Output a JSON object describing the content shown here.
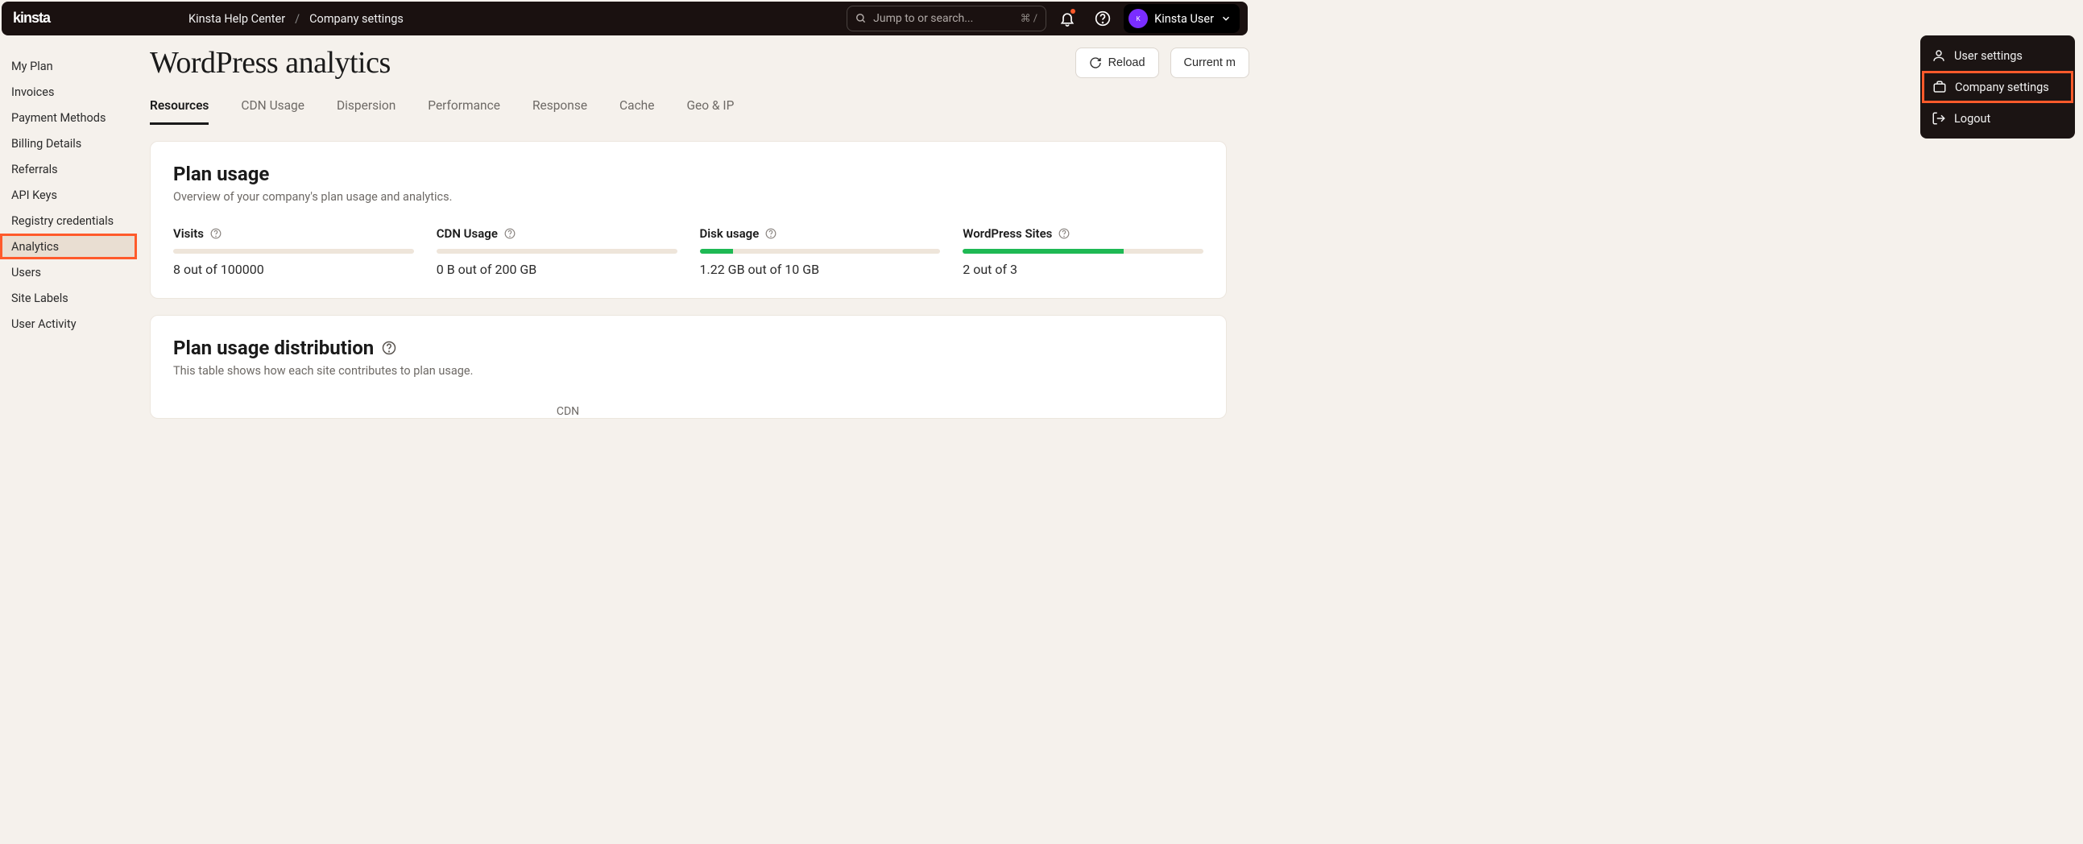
{
  "header": {
    "logo_text": "kinsta",
    "breadcrumb": [
      "Kinsta Help Center",
      "Company settings"
    ],
    "search_placeholder": "Jump to or search...",
    "search_kbd": "⌘ /",
    "user_name": "Kinsta User"
  },
  "user_menu": {
    "items": [
      {
        "label": "User settings"
      },
      {
        "label": "Company settings",
        "highlight": true
      },
      {
        "label": "Logout"
      }
    ]
  },
  "sidebar": {
    "items": [
      "My Plan",
      "Invoices",
      "Payment Methods",
      "Billing Details",
      "Referrals",
      "API Keys",
      "Registry credentials",
      "Analytics",
      "Users",
      "Site Labels",
      "User Activity"
    ],
    "active": "Analytics"
  },
  "page": {
    "title": "WordPress analytics",
    "reload_label": "Reload",
    "period_label": "Current m"
  },
  "tabs": [
    "Resources",
    "CDN Usage",
    "Dispersion",
    "Performance",
    "Response",
    "Cache",
    "Geo & IP"
  ],
  "tabs_active": "Resources",
  "plan_usage": {
    "title": "Plan usage",
    "subtitle": "Overview of your company's plan usage and analytics.",
    "metrics": [
      {
        "name": "Visits",
        "value": "8 out of 100000",
        "fill_pct": 0
      },
      {
        "name": "CDN Usage",
        "value": "0 B out of 200 GB",
        "fill_pct": 0
      },
      {
        "name": "Disk usage",
        "value": "1.22 GB out of 10 GB",
        "fill_pct": 14
      },
      {
        "name": "WordPress Sites",
        "value": "2 out of 3",
        "fill_pct": 67
      }
    ]
  },
  "distribution": {
    "title": "Plan usage distribution",
    "subtitle": "This table shows how each site contributes to plan usage.",
    "partial_col": "CDN"
  }
}
